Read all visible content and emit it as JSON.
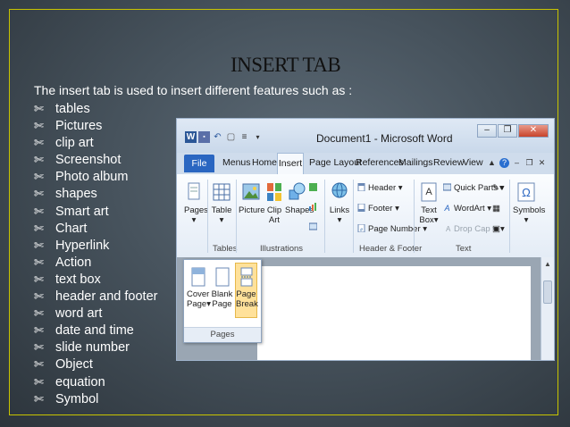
{
  "slide": {
    "title": "INSERT TAB",
    "intro": "The insert tab is used to insert different features such as :",
    "bullet_glyph": "✄",
    "bullets": [
      "tables",
      "Pictures",
      "clip art",
      "Screenshot",
      "Photo album",
      "shapes",
      "Smart art",
      "Chart",
      "Hyperlink",
      "Action",
      "text box",
      "header and footer",
      "word art",
      "date and time",
      "slide number",
      "Object",
      "equation",
      "Symbol"
    ]
  },
  "word": {
    "window_title": "Document1 - Microsoft Word",
    "tabs": {
      "file": "File",
      "menus": "Menus",
      "home": "Home",
      "insert": "Insert",
      "page_layout": "Page Layout",
      "references": "References",
      "mailings": "Mailings",
      "review": "Review",
      "view": "View"
    },
    "ribbon": {
      "pages": "Pages",
      "table": "Table",
      "picture": "Picture",
      "clip_art": "Clip Art",
      "shapes": "Shapes",
      "links": "Links",
      "header": "Header",
      "footer": "Footer",
      "page_number": "Page Number",
      "text_box": "Text Box",
      "quick_parts": "Quick Parts",
      "wordart": "WordArt",
      "drop_cap": "Drop Cap",
      "symbols": "Symbols",
      "groups": {
        "tables": "Tables",
        "illustrations": "Illustrations",
        "header_footer": "Header & Footer",
        "text": "Text"
      }
    },
    "pages_dropdown": {
      "cover_page": "Cover Page",
      "blank_page": "Blank Page",
      "page_break": "Page Break",
      "group_label": "Pages"
    }
  }
}
